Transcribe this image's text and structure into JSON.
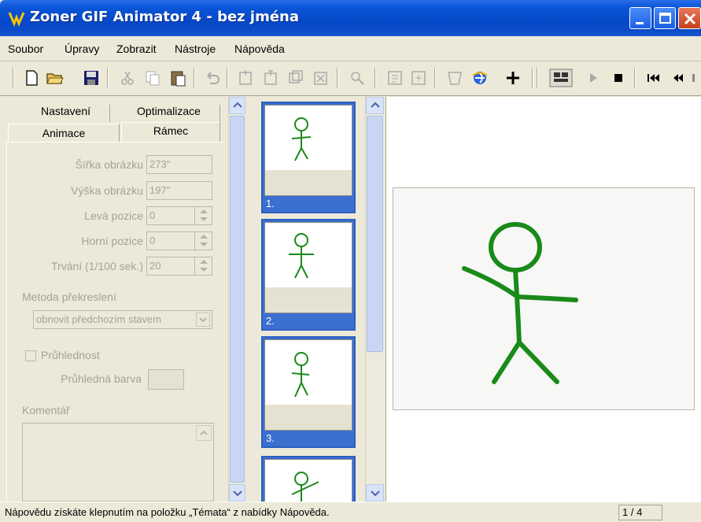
{
  "window": {
    "title": "Zoner GIF Animator 4 - bez jména"
  },
  "menu": [
    "Soubor",
    "Úpravy",
    "Zobrazit",
    "Nástroje",
    "Nápověda"
  ],
  "toolbar": {
    "icons": [
      "new-icon",
      "open-icon",
      "save-icon",
      "cut-icon",
      "copy-icon",
      "paste-icon",
      "undo-icon",
      "add-frame-icon",
      "insert-frame-icon",
      "duplicate-frame-icon",
      "delete-frame-icon",
      "optimize-icon",
      "properties-icon",
      "expand-icon",
      "wizard-icon",
      "browser-preview-icon",
      "add-icon",
      "animation-icon",
      "play-icon",
      "stop-icon",
      "first-frame-icon",
      "prev-frame-icon"
    ]
  },
  "tabs": {
    "row_back": [
      "Nastavení",
      "Optimalizace"
    ],
    "row_front": [
      "Animace",
      "Rámec"
    ],
    "active": "Rámec"
  },
  "frame_props": {
    "width_label": "Šířka obrázku",
    "width_value": "273\"",
    "height_label": "Výška obrázku",
    "height_value": "197\"",
    "left_label": "Levá pozice",
    "left_value": "0",
    "top_label": "Horní pozice",
    "top_value": "0",
    "duration_label": "Trvání (1/100 sek.)",
    "duration_value": "20",
    "redraw_label": "Metoda překreslení",
    "redraw_value": "obnovit předchozím stavem",
    "transparency_label": "Průhlednost",
    "transparent_color_label": "Průhledná barva",
    "comment_label": "Komentář"
  },
  "frames": [
    {
      "number": "1."
    },
    {
      "number": "2."
    },
    {
      "number": "3."
    },
    {
      "number": ""
    }
  ],
  "status": {
    "text": "Nápovědu získáte klepnutím na položku „Témata“ z nabídky Nápověda.",
    "frame_counter": "1 / 4"
  },
  "colors": {
    "titlebar": "#0a55d8",
    "selection": "#3b6fd0",
    "stick_figure": "#1a8a1a",
    "desktop": "#c23a12"
  }
}
